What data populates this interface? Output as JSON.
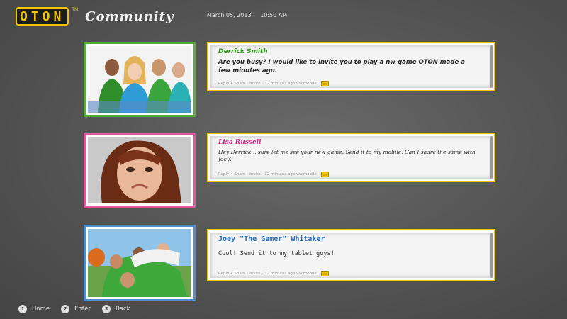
{
  "header": {
    "logo": "OTON",
    "trademark": "TM",
    "title": "Community",
    "date": "March 05, 2013",
    "time": "10:50 AM"
  },
  "posts": [
    {
      "author": "Derrick Smith",
      "author_color": "#2d9a1a",
      "frame_color": "#55b03a",
      "message": "Are you busy? I would like to invite you to play a nw game OTON made a few minutes ago.",
      "actions": [
        "Reply",
        "Share",
        "Invite"
      ],
      "timestamp": "12 minutes ago via mobile"
    },
    {
      "author": "Lisa Russell",
      "author_color": "#d9268b",
      "frame_color": "#e6549c",
      "message": "Hey Derrick... sure let me see your new game. Send it to my mobile. Can I share the same with Joey?",
      "actions": [
        "Reply",
        "Share",
        "Invite"
      ],
      "timestamp": "12 minutes ago via mobile"
    },
    {
      "author": "Joey \"The Gamer\" Whitaker",
      "author_color": "#1f6fc8",
      "frame_color": "#4a8fd6",
      "message": "Cool! Send it to my tablet guys!",
      "actions": [
        "Reply",
        "Share",
        "Invite"
      ],
      "timestamp": "12 minutes ago via mobile"
    }
  ],
  "nav": [
    {
      "key": "1",
      "label": "Home"
    },
    {
      "key": "2",
      "label": "Enter"
    },
    {
      "key": "3",
      "label": "Back"
    }
  ],
  "icons": {
    "mobile": "mobile-icon"
  }
}
